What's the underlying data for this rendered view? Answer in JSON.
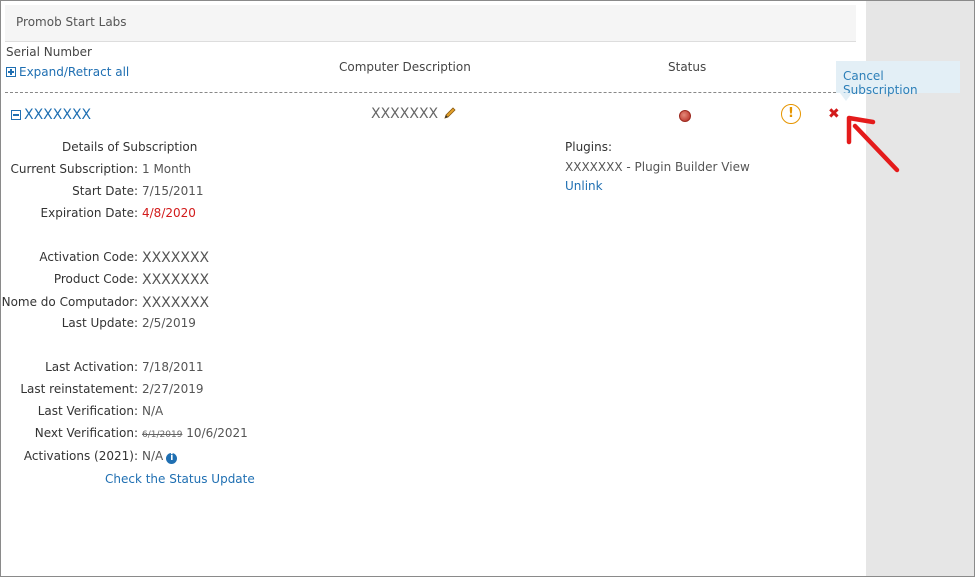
{
  "panel": {
    "title": "Promob Start Labs"
  },
  "columns": {
    "serial": "Serial Number",
    "expand": "Expand/Retract all",
    "description": "Computer Description",
    "status": "Status"
  },
  "row": {
    "serial": "XXXXXXX",
    "description": "XXXXXXX",
    "status_color": "#c0392b"
  },
  "tooltip": {
    "text": "Cancel Subscription"
  },
  "details": {
    "heading": "Details of Subscription",
    "current_subscription": {
      "label": "Current Subscription:",
      "value": "1 Month"
    },
    "start_date": {
      "label": "Start Date:",
      "value": "7/15/2011"
    },
    "expiration_date": {
      "label": "Expiration Date:",
      "value": "4/8/2020"
    },
    "activation_code": {
      "label": "Activation Code:",
      "value": "XXXXXXX"
    },
    "product_code": {
      "label": "Product Code:",
      "value": "XXXXXXX"
    },
    "computer_name": {
      "label": "Nome do Computador:",
      "value": "XXXXXXX"
    },
    "last_update": {
      "label": "Last Update:",
      "value": "2/5/2019"
    },
    "last_activation": {
      "label": "Last Activation:",
      "value": "7/18/2011"
    },
    "last_reinstatement": {
      "label": "Last reinstatement:",
      "value": "2/27/2019"
    },
    "last_verification": {
      "label": "Last Verification:",
      "value": "N/A"
    },
    "next_verification": {
      "label": "Next Verification:",
      "old_value": "6/1/2019",
      "value": "10/6/2021"
    },
    "activations": {
      "label": "Activations (2021):",
      "value": "N/A"
    },
    "check_link": "Check the Status Update"
  },
  "plugins": {
    "label": "Plugins:",
    "item": "XXXXXXX - Plugin Builder View",
    "unlink": "Unlink"
  },
  "colors": {
    "link": "#1f6fb2",
    "danger": "#d21b1b",
    "warning": "#e69500",
    "tooltip_bg": "#e3eff6"
  }
}
